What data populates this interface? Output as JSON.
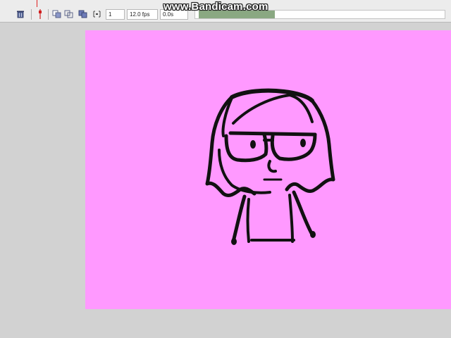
{
  "watermark": {
    "text": "www.Bandicam.com"
  },
  "toolbar": {
    "icons": [
      "trash-icon",
      "onion-skin-icon",
      "onion-outline-icon",
      "edit-multiple-frames-icon",
      "onion-markers-icon"
    ],
    "current_frame": "1",
    "frame_rate": "12.0 fps",
    "elapsed_time": "0.0s"
  },
  "stage": {
    "background_color": "#ff99ff"
  },
  "colors": {
    "panel_bg": "#ececec",
    "work_area_bg": "#d2d2d2",
    "scroll_thumb": "#8aa882",
    "playhead": "#e02020",
    "ink": "#111111"
  }
}
